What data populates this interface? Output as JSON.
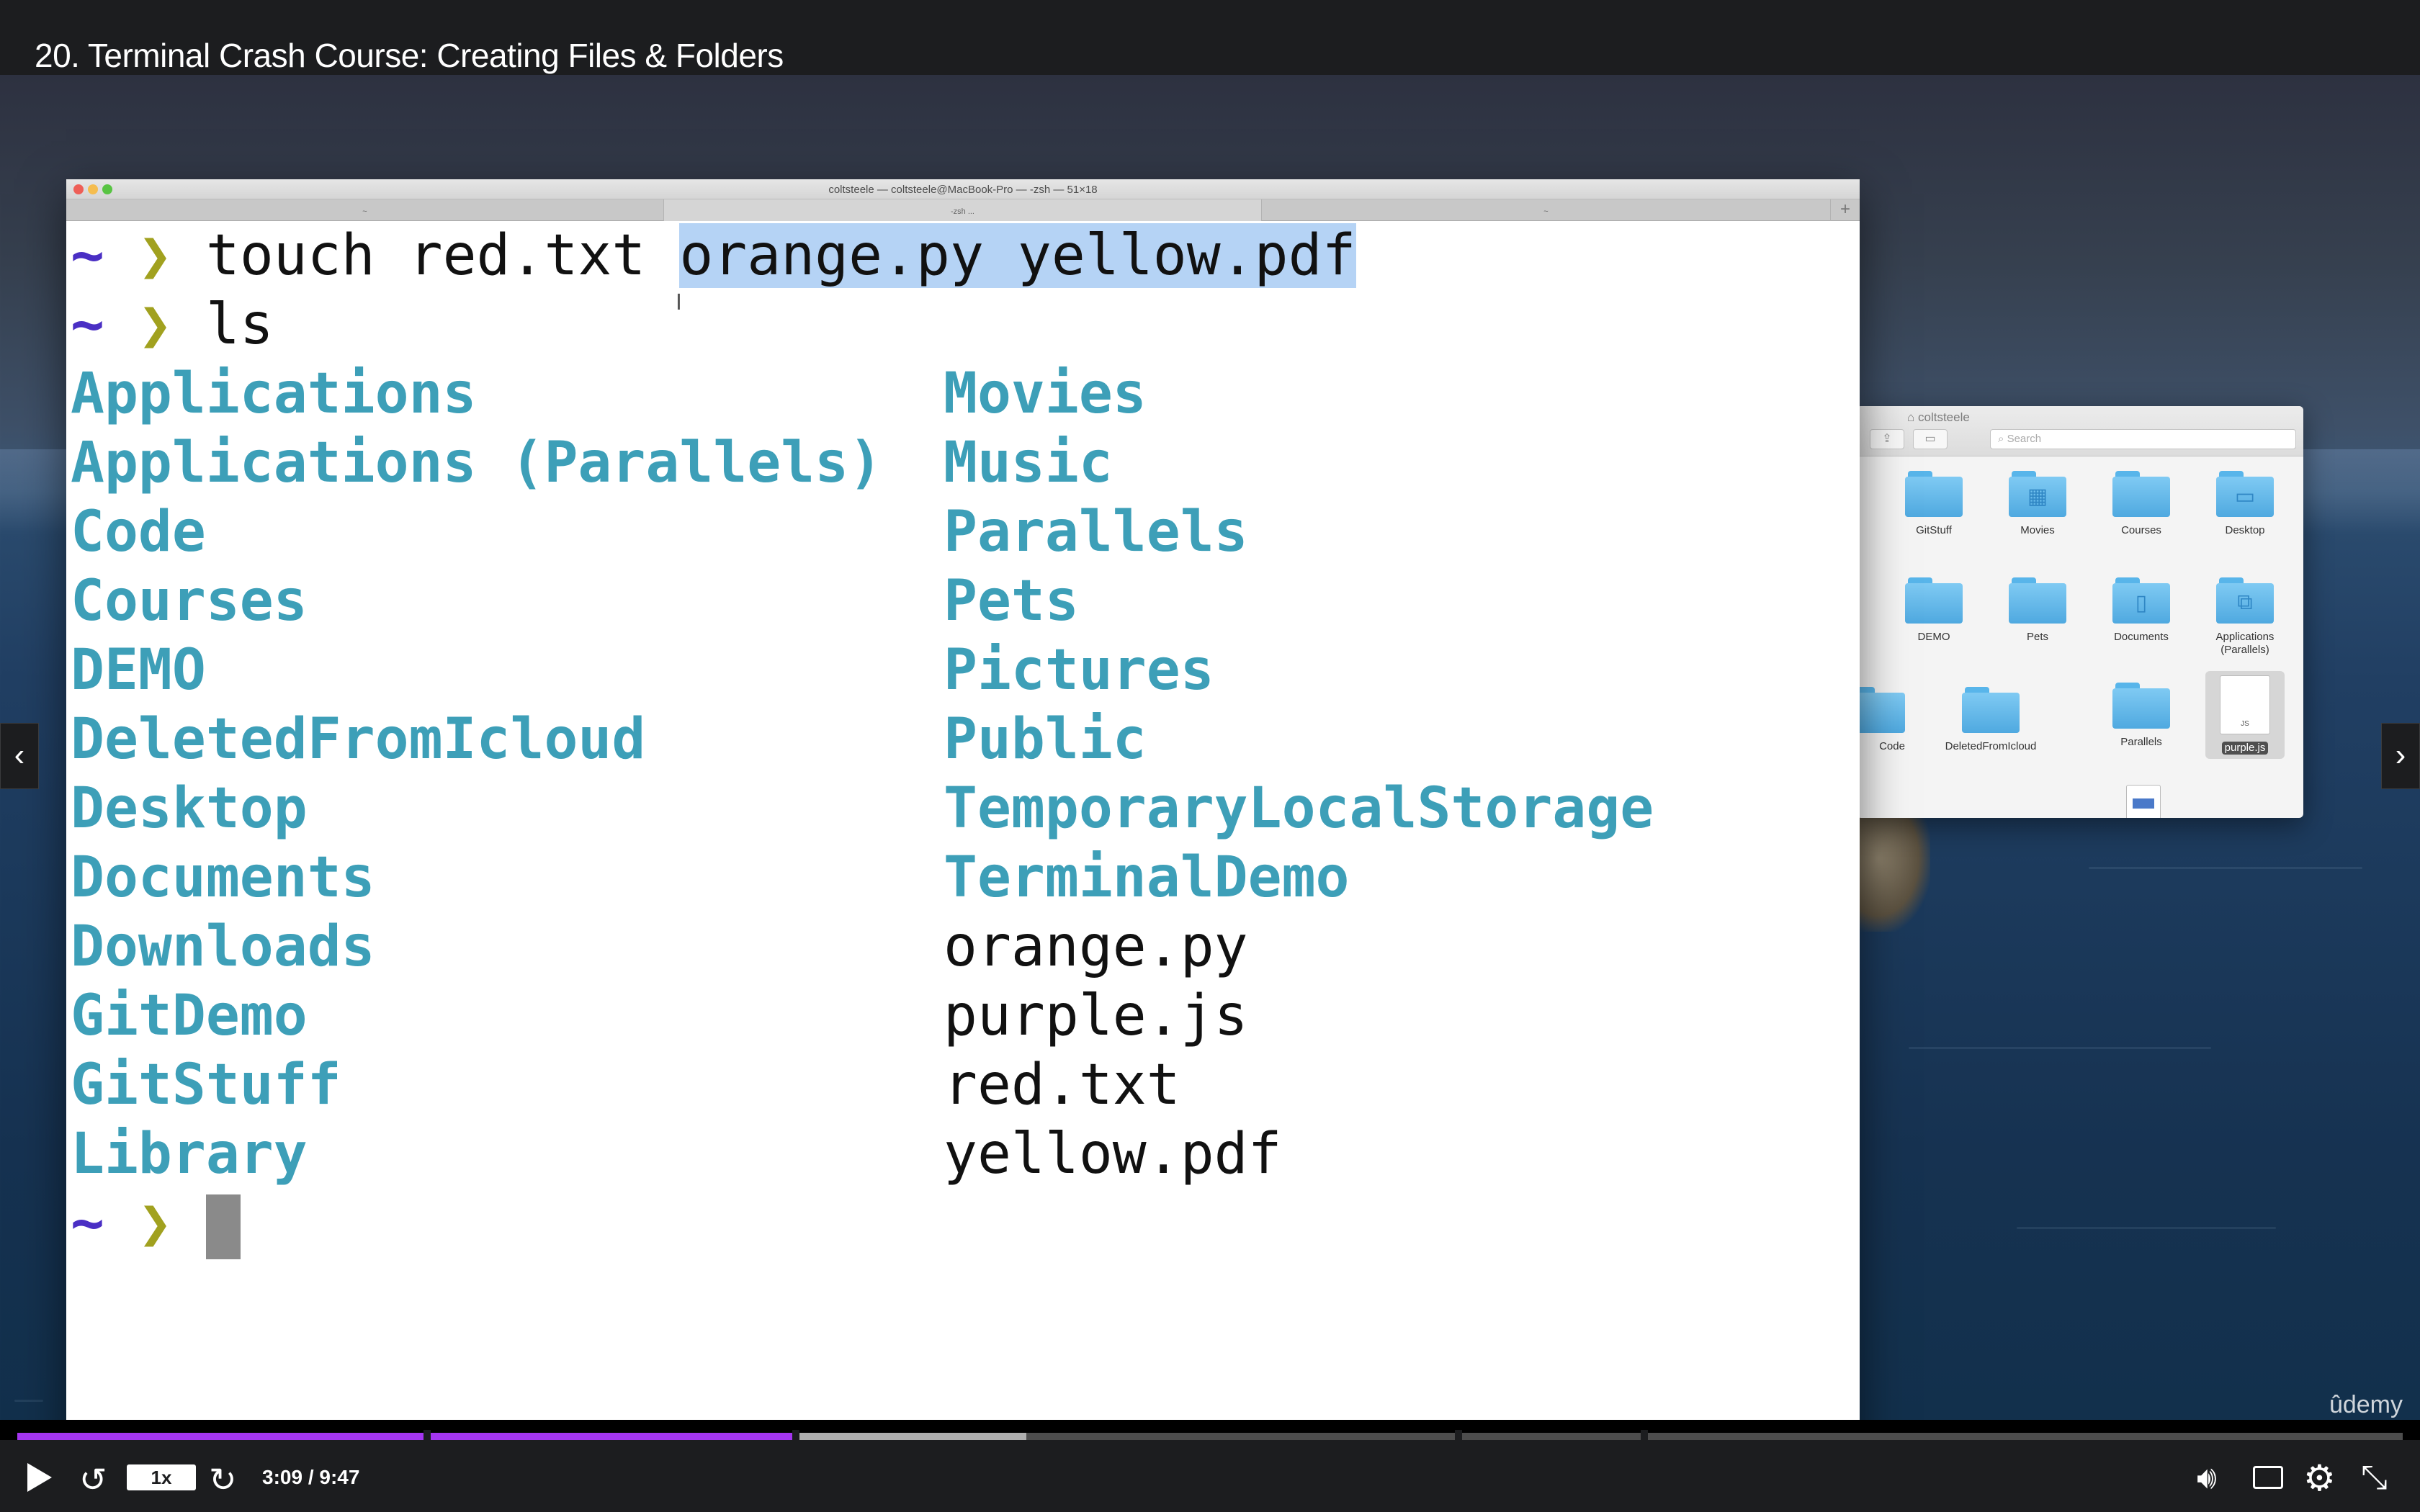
{
  "player": {
    "lecture_title": "20. Terminal Crash Course: Creating Files & Folders",
    "speed": "1x",
    "time": "3:09 / 9:47",
    "progress_fraction": 0.327,
    "buffered_fraction": 0.423,
    "watermark": "ûdemy",
    "accent_color": "#a435f0",
    "icons": {
      "play": "play-icon",
      "rewind": "rewind-icon",
      "forward": "forward-icon",
      "volume": "volume-icon",
      "captions": "captions-icon",
      "settings": "gear-icon",
      "exit_fullscreen": "exit-fullscreen-icon",
      "prev": "chevron-left-icon",
      "next": "chevron-right-icon"
    }
  },
  "terminal": {
    "window_title": "coltsteele — coltsteele@MacBook-Pro — -zsh — 51×18",
    "tabs": [
      "~",
      "-zsh ...",
      "~"
    ],
    "prompt_tilde": "~",
    "prompt_chevron": "❯",
    "command1_plain": "touch red.txt",
    "command1_selected": "orange.py yellow.pdf",
    "command2": "ls",
    "dir_color": "#3d9fb8",
    "listing_left": [
      "Applications",
      "Applications (Parallels)",
      "Code",
      "Courses",
      "DEMO",
      "DeletedFromIcloud",
      "Desktop",
      "Documents",
      "Downloads",
      "GitDemo",
      "GitStuff",
      "Library"
    ],
    "listing_right": [
      {
        "name": "Movies",
        "is_dir": true
      },
      {
        "name": "Music",
        "is_dir": true
      },
      {
        "name": "Parallels",
        "is_dir": true
      },
      {
        "name": "Pets",
        "is_dir": true
      },
      {
        "name": "Pictures",
        "is_dir": true
      },
      {
        "name": "Public",
        "is_dir": true
      },
      {
        "name": "TemporaryLocalStorage",
        "is_dir": true
      },
      {
        "name": "TerminalDemo",
        "is_dir": true
      },
      {
        "name": "orange.py",
        "is_dir": false
      },
      {
        "name": "purple.js",
        "is_dir": false
      },
      {
        "name": "red.txt",
        "is_dir": false
      },
      {
        "name": "yellow.pdf",
        "is_dir": false
      }
    ]
  },
  "finder": {
    "title": "coltsteele",
    "search_placeholder": "Search",
    "items": [
      {
        "label": "GitStuff",
        "icon": "folder-icon"
      },
      {
        "label": "Movies",
        "icon": "movies-folder-icon"
      },
      {
        "label": "Courses",
        "icon": "folder-icon"
      },
      {
        "label": "Desktop",
        "icon": "desktop-folder-icon"
      },
      {
        "label": "DEMO",
        "icon": "folder-icon"
      },
      {
        "label": "Pets",
        "icon": "folder-icon"
      },
      {
        "label": "Documents",
        "icon": "documents-folder-icon"
      },
      {
        "label": "Applications (Parallels)",
        "icon": "applications-folder-icon"
      },
      {
        "label": "Code",
        "icon": "folder-icon"
      },
      {
        "label": "DeletedFromIcloud",
        "icon": "folder-icon"
      },
      {
        "label": "Parallels",
        "icon": "folder-icon"
      },
      {
        "label": "purple.js",
        "icon": "js-file-icon"
      }
    ]
  }
}
